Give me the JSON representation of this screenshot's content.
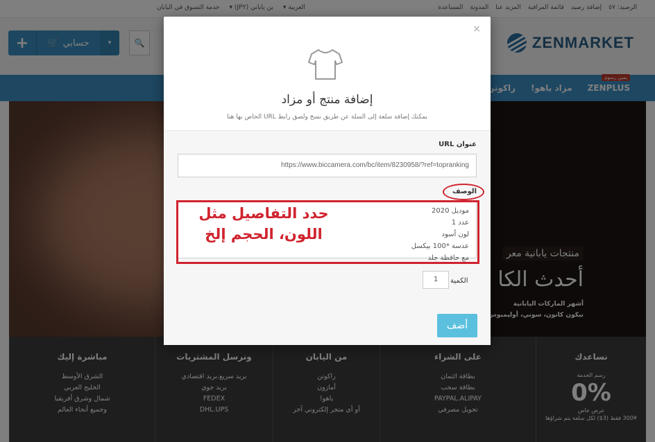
{
  "topbar": {
    "balance": "الرصيد: ٥٧",
    "add_balance": "إضافة رصيد",
    "watchlist": "قائمة المراقبة",
    "about": "المزيد عنا",
    "blog": "المدونة",
    "help": "المساعدة",
    "language": "العربية ▾",
    "currency": "ين ياباني (JPY) ▾",
    "service": "خدمة التسوق في اليابان"
  },
  "header": {
    "logo_text": "ZENMARKET",
    "account_label": "حسابي",
    "plus_label": "+",
    "caret": "▾",
    "search_icon": "🔍"
  },
  "nav": {
    "badge": "يمين رسوم",
    "items": [
      "ZENPLUS",
      "مزاد ياهو!",
      "راكوتن"
    ]
  },
  "hero": {
    "tag": "منتجات يابانية معر",
    "title": "أحدث الكا",
    "line1": "أشهر الماركات اليابانية",
    "line2": "نيكون كانون، سوني، أوليمبوس و"
  },
  "footer": {
    "cols": [
      {
        "title": "نساعدك",
        "big": "0%",
        "pre": "رسم الخدمة",
        "small1": "عرض خاص",
        "small2": "300¥ فقط (3$) لكل سلعة يتم شراؤها"
      },
      {
        "title": "على الشراء",
        "links": [
          "بطاقة ائتمان",
          "بطاقة سحب",
          "PAYPAL.ALIPAY",
          "تحويل مصرفي"
        ]
      },
      {
        "title": "من اليابان",
        "links": [
          "راكوتن",
          "أمازون",
          "ياهو!",
          "أو أي متجر إلكتروني آخر"
        ]
      },
      {
        "title": "ونرسل المشتريات",
        "links": [
          "بريد سريع.بريد اقتصادي",
          "بريد جوي",
          "FEDEX",
          "DHL.UPS"
        ]
      },
      {
        "title": "مباشرة إليك",
        "links": [
          "الشرق الأوسط",
          "الخليج العربي",
          "شمال وشرق أفريقيا",
          "وجميع أنحاء العالم"
        ]
      }
    ]
  },
  "modal": {
    "close": "×",
    "title": "إضافة منتج أو مزاد",
    "subtitle": "يمكنك إضافة سلعة إلى السلة عن طريق نسخ ولصق رابط URL الخاص بها هنا",
    "url_label": "عنوان URL",
    "url_value": "https://www.biccamera.com/bc/item/8230958/?ref=topranking",
    "desc_label": "الوصف",
    "desc_lines": [
      "موديل 2020",
      "عدد 1",
      "لون أسود",
      "عدسة *100 بيكسل",
      "مع حافظة جلد"
    ],
    "annotation_line1": "حدد التفاصيل مثل",
    "annotation_line2": "اللون، الحجم إلخ",
    "qty_label": "الكمية",
    "qty_value": "1",
    "add_button": "أضف"
  }
}
